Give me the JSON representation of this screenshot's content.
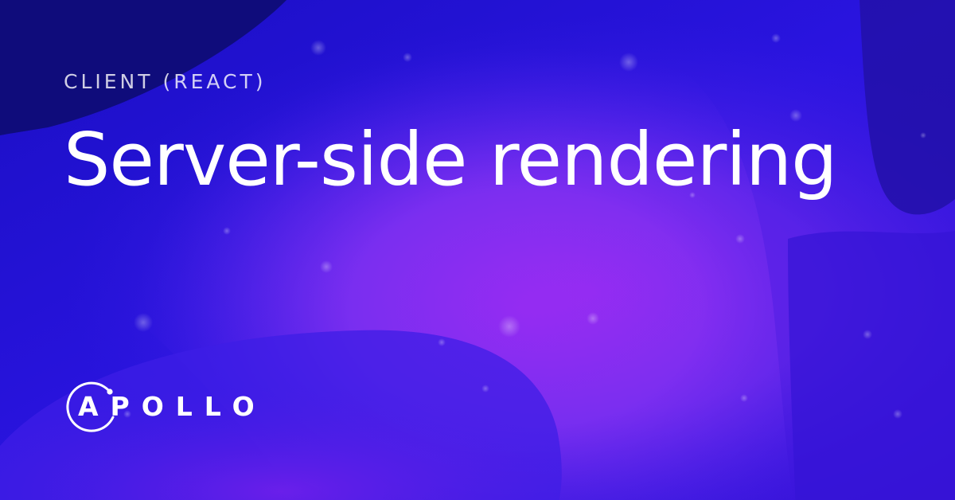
{
  "eyebrow": "CLIENT (REACT)",
  "title": "Server-side rendering",
  "logo": {
    "wordmark": "APOLLO",
    "icon": "apollo-logo-icon"
  },
  "colors": {
    "background_dark": "#0c0a6b",
    "background_blue": "#2a14d8",
    "background_violet": "#8a2ef0",
    "text": "#ffffff"
  }
}
